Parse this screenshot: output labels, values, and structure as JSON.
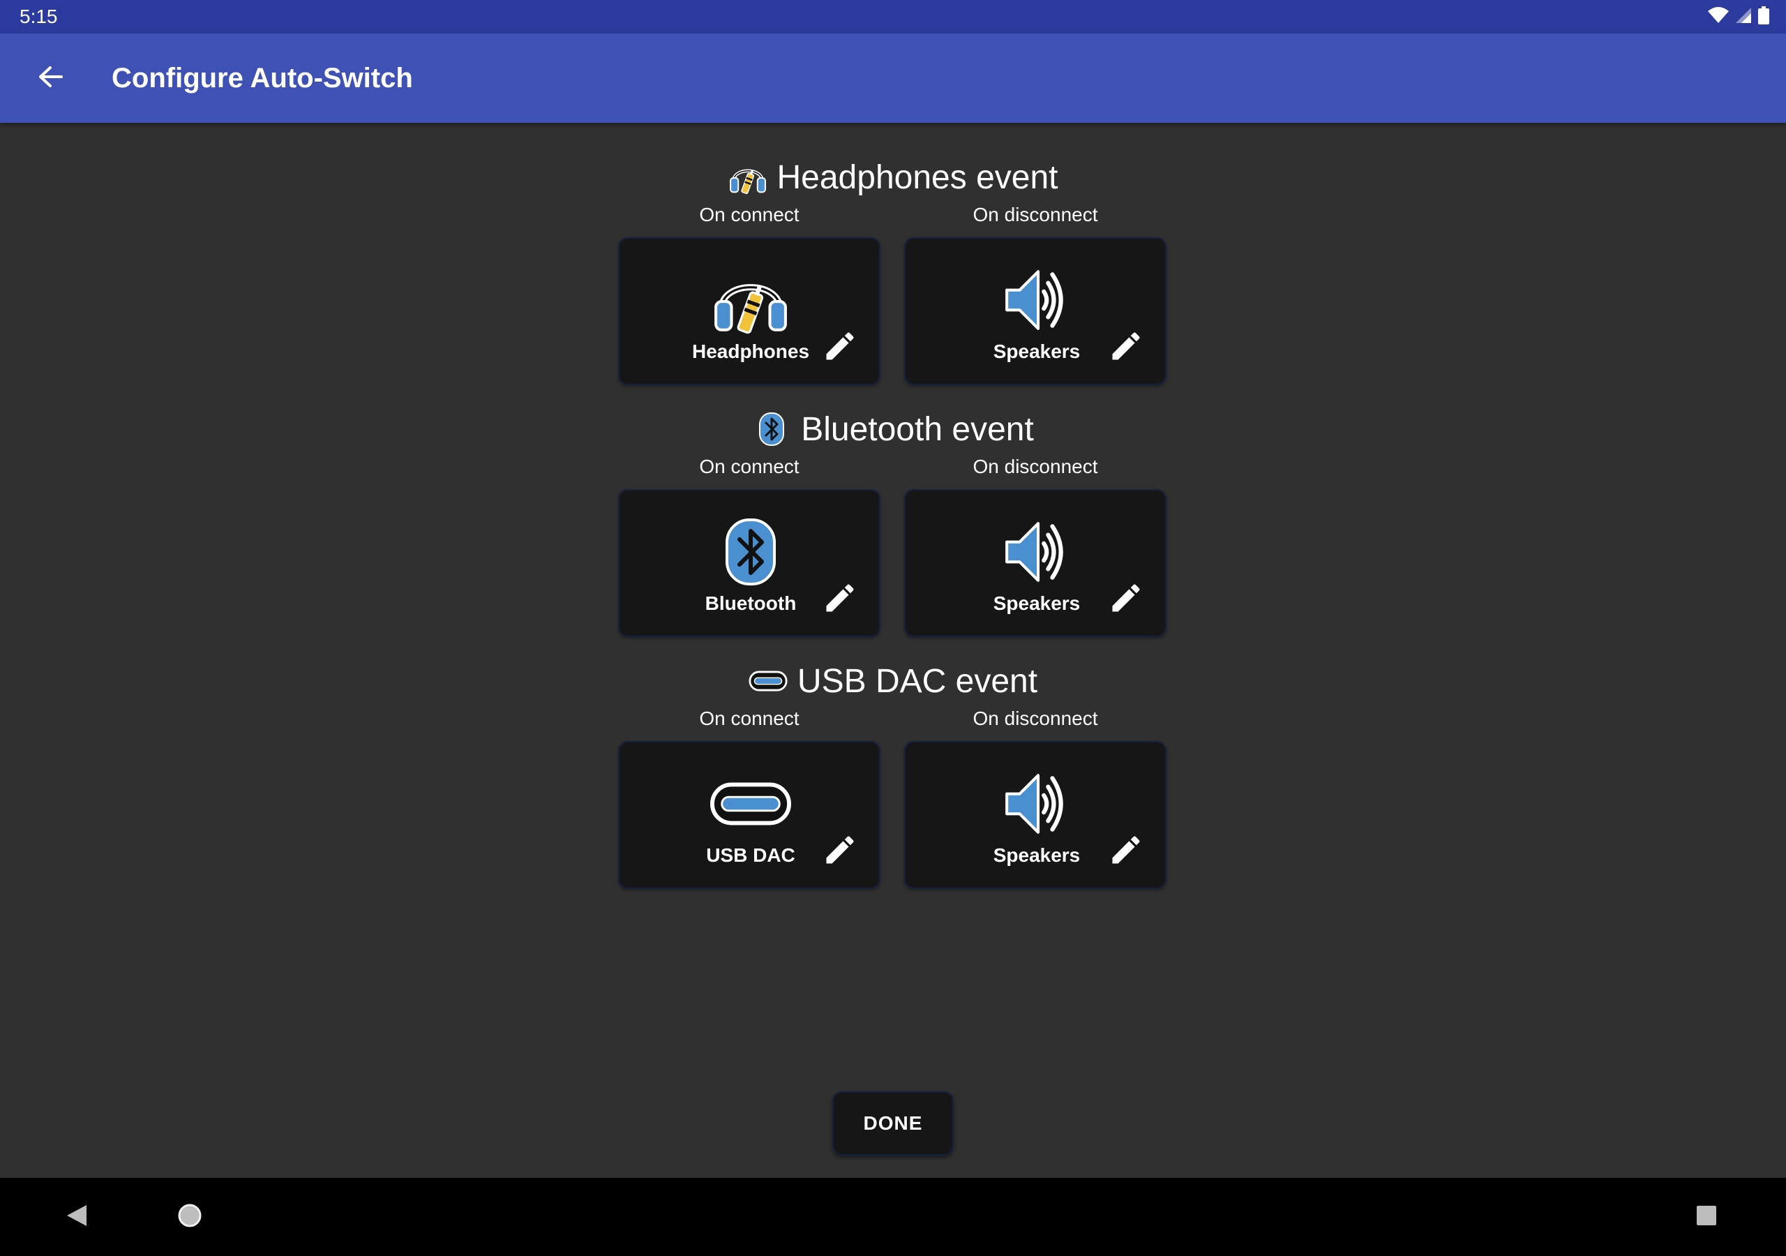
{
  "status_bar": {
    "time": "5:15",
    "icons": [
      "wifi-icon",
      "signal-icon",
      "battery-icon"
    ]
  },
  "app_bar": {
    "title": "Configure Auto-Switch",
    "back_icon": "arrow-back-icon"
  },
  "sections": [
    {
      "title": "Headphones event",
      "icon": "headphones-icon",
      "connect_label": "On connect",
      "disconnect_label": "On disconnect",
      "connect_device": "Headphones",
      "disconnect_device": "Speakers"
    },
    {
      "title": "Bluetooth event",
      "icon": "bluetooth-icon",
      "connect_label": "On connect",
      "disconnect_label": "On disconnect",
      "connect_device": "Bluetooth",
      "disconnect_device": "Speakers"
    },
    {
      "title": "USB DAC event",
      "icon": "usb-c-icon",
      "connect_label": "On connect",
      "disconnect_label": "On disconnect",
      "connect_device": "USB DAC",
      "disconnect_device": "Speakers"
    }
  ],
  "done_button": "DONE",
  "colors": {
    "status_bar": "#2b3a9c",
    "app_bar": "#3f51b5",
    "background": "#303030",
    "card": "#161616",
    "icon_blue": "#4a90d0",
    "icon_yellow": "#f2c23a"
  }
}
